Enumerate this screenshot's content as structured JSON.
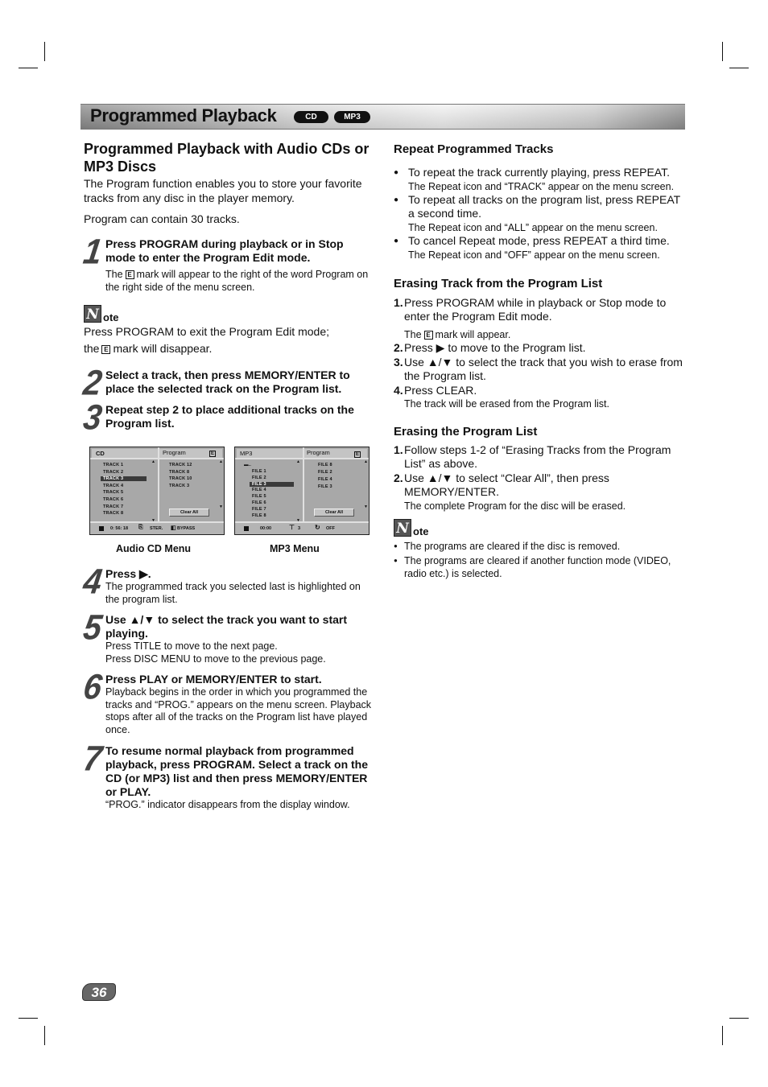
{
  "header": {
    "title": "Programmed Playback",
    "badges": [
      "CD",
      "MP3"
    ]
  },
  "left": {
    "section_title": "Programmed Playback with Audio CDs or MP3 Discs",
    "intro": "The Program function enables you to store your favorite tracks from any disc in the player memory.",
    "capacity": "Program can contain 30 tracks.",
    "steps": [
      {
        "num": "1",
        "head": "Press PROGRAM during playback or in Stop mode to enter the Program Edit mode.",
        "sub_before": "The",
        "sub_after": "mark will appear to the right of the word Program on the right side of the menu screen."
      },
      {
        "num": "2",
        "head": "Select a track, then press MEMORY/ENTER to place the selected track on the Program list."
      },
      {
        "num": "3",
        "head": "Repeat step 2 to place additional tracks on the Program list."
      },
      {
        "num": "4",
        "head": "Press ▶.",
        "sub": "The programmed track you selected last is highlighted on the program list."
      },
      {
        "num": "5",
        "head": "Use ▲/▼ to select the track you want to start playing.",
        "sub": "Press TITLE to move to the next page.",
        "sub2": "Press DISC MENU to move to the previous page."
      },
      {
        "num": "6",
        "head": "Press PLAY or MEMORY/ENTER to start.",
        "sub": "Playback begins in the order in which you programmed the tracks and “PROG.” appears on the menu screen. Playback stops after all of the tracks on the Program list have played once."
      },
      {
        "num": "7",
        "head": "To resume normal playback from programmed playback, press PROGRAM. Select a track on the CD (or MP3) list and then press MEMORY/ENTER or PLAY.",
        "sub": "“PROG.” indicator disappears from the display window."
      }
    ],
    "note": {
      "word": "ote",
      "line1": "Press PROGRAM to exit the Program Edit mode;",
      "line2_before": "the",
      "line2_after": "mark will disappear."
    },
    "emark": "E"
  },
  "menus": {
    "cd": {
      "caption": "Audio CD Menu",
      "left_title": "CD",
      "right_title": "Program",
      "tracks": [
        "TRACK 1",
        "TRACK 2",
        "TRACK 3",
        "TRACK 4",
        "TRACK 5",
        "TRACK 6",
        "TRACK 7",
        "TRACK 8"
      ],
      "selected_index": 2,
      "program": [
        "TRACK 12",
        "TRACK 8",
        "TRACK 10",
        "TRACK 3"
      ],
      "clear_all": "Clear All",
      "status_time": "0: 56: 18",
      "status_audio": "STER.",
      "status_sound": "BYPASS"
    },
    "mp3": {
      "caption": "MP3 Menu",
      "left_title": "MP3",
      "right_title": "Program",
      "parent": "..",
      "files": [
        "FILE 1",
        "FILE 2",
        "FILE 3",
        "FILE 4",
        "FILE 5",
        "FILE 6",
        "FILE 7",
        "FILE 8"
      ],
      "selected_index": 2,
      "program": [
        "FILE 8",
        "FILE 2",
        "FILE 4",
        "FILE 3"
      ],
      "clear_all": "Clear All",
      "status_time": "00:00",
      "status_count": "3",
      "status_repeat": "OFF"
    }
  },
  "right": {
    "repeat": {
      "title": "Repeat Programmed Tracks",
      "items": [
        {
          "text": "To repeat the track currently playing, press REPEAT.",
          "sub": "The Repeat icon and “TRACK” appear on the menu screen."
        },
        {
          "text": "To repeat all tracks on the program list, press REPEAT a second time.",
          "sub": "The Repeat icon and “ALL” appear on the menu screen."
        },
        {
          "text": "To cancel Repeat mode, press REPEAT a third time.",
          "sub": "The Repeat icon and “OFF” appear on the menu screen."
        }
      ]
    },
    "erase_track": {
      "title": "Erasing Track from the Program List",
      "steps": [
        {
          "n": "1.",
          "text": "Press PROGRAM while in playback or Stop mode to enter the Program Edit mode."
        },
        {
          "n": "2.",
          "text": "Press ▶ to move to the Program list."
        },
        {
          "n": "3.",
          "text": "Use ▲/▼ to select the track that you wish to erase from the Program list."
        },
        {
          "n": "4.",
          "text": "Press CLEAR."
        }
      ],
      "sub1_before": "The",
      "sub1_after": "mark will appear.",
      "sub4": "The track will be erased from the Program list."
    },
    "erase_list": {
      "title": "Erasing the Program List",
      "steps": [
        {
          "n": "1.",
          "text": "Follow steps 1-2 of “Erasing Tracks from the Program List” as above."
        },
        {
          "n": "2.",
          "text": "Use ▲/▼ to select “Clear All”, then press MEMORY/ENTER."
        }
      ],
      "sub2": "The complete Program for the disc will be erased."
    },
    "note": {
      "word": "ote",
      "items": [
        "The programs are cleared if the disc is removed.",
        "The programs are cleared if another function mode (VIDEO, radio etc.) is selected."
      ]
    }
  },
  "footer": {
    "page_number": "36"
  }
}
